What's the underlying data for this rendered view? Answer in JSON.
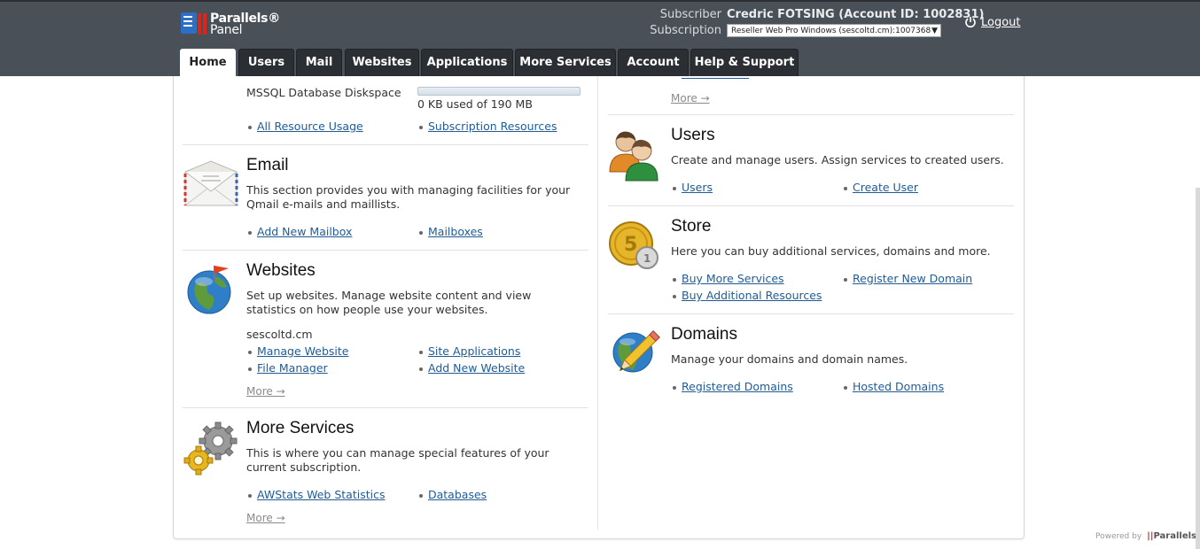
{
  "brand": {
    "line1": "Parallels®",
    "line2": "Panel"
  },
  "account": {
    "subscriber_label": "Subscriber",
    "subscriber_value": "Credric FOTSING (Account ID: 1002831)",
    "subscription_label": "Subscription",
    "subscription_value": "Reseller Web Pro Windows (sescoltd.cm):1007368",
    "logout": "Logout"
  },
  "tabs": [
    "Home",
    "Users",
    "Mail",
    "Websites",
    "Applications",
    "More Services",
    "Account",
    "Help & Support"
  ],
  "left": {
    "resources": {
      "label": "MSSQL Database Diskspace",
      "usage": "0 KB used of 190 MB",
      "usage_fraction": 0,
      "links": [
        "All Resource Usage",
        "Subscription Resources"
      ]
    },
    "email": {
      "title": "Email",
      "desc": "This section provides you with managing facilities for your Qmail e-mails and maillists.",
      "links": [
        "Add New Mailbox",
        "Mailboxes"
      ]
    },
    "websites": {
      "title": "Websites",
      "desc": "Set up websites. Manage website content and view statistics on how people use your websites.",
      "domain": "sescoltd.cm",
      "links": [
        "Manage Website",
        "Site Applications",
        "File Manager",
        "Add New Website"
      ],
      "more": "More →"
    },
    "more_services": {
      "title": "More Services",
      "desc": "This is where you can manage special features of your current subscription.",
      "links": [
        "AWStats Web Statistics",
        "Databases"
      ],
      "more": "More →"
    }
  },
  "right": {
    "top_more": "More →",
    "users": {
      "title": "Users",
      "desc": "Create and manage users. Assign services to created users.",
      "links": [
        "Users",
        "Create User"
      ]
    },
    "store": {
      "title": "Store",
      "desc": "Here you can buy additional services, domains and more.",
      "links": [
        "Buy More Services",
        "Register New Domain",
        "Buy Additional Resources"
      ]
    },
    "domains": {
      "title": "Domains",
      "desc": "Manage your domains and domain names.",
      "links": [
        "Registered Domains",
        "Hosted Domains"
      ]
    }
  },
  "footer": {
    "powered_by": "Powered by",
    "brand": "Parallels"
  },
  "colors": {
    "header": "#4a5057",
    "tab": "#2b2f33",
    "link": "#1f5c97"
  }
}
